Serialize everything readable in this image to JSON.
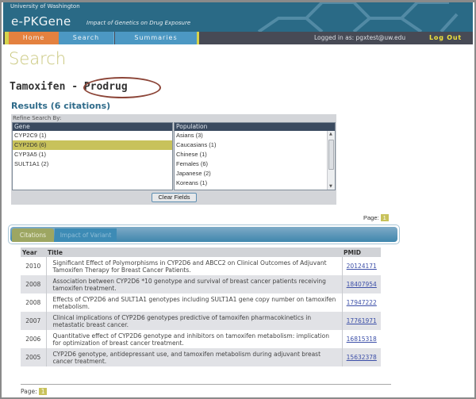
{
  "header": {
    "university": "University of Washington",
    "brand": "e-PKGene",
    "tagline": "Impact of Genetics on Drug Exposure"
  },
  "nav": {
    "tabs": [
      {
        "label": "Home",
        "active": true
      },
      {
        "label": "Search",
        "active": false
      },
      {
        "label": "Summaries",
        "active": false
      }
    ],
    "logged_in": "Logged in as: pgxtest@uw.edu",
    "logout": "Log Out"
  },
  "page": {
    "title": "Search",
    "drug_heading": "Tamoxifen - Prodrug",
    "results": "Results (6 citations)"
  },
  "refine": {
    "label": "Refine Search By:",
    "gene": {
      "header": "Gene",
      "items": [
        "CYP2C9 (1)",
        "CYP2D6 (6)",
        "CYP3A5 (1)",
        "SULT1A1 (2)"
      ],
      "selected": "CYP2D6 (6)"
    },
    "population": {
      "header": "Population",
      "items": [
        "Asians (3)",
        "Caucasians (1)",
        "Chinese (1)",
        "Females (6)",
        "Japanese (2)",
        "Koreans (1)"
      ]
    },
    "clear_button": "Clear Fields"
  },
  "pagination": {
    "label": "Page:",
    "current": "1"
  },
  "tabs": [
    {
      "label": "Citations",
      "active": true
    },
    {
      "label": "Impact of Variant",
      "active": false
    }
  ],
  "table": {
    "columns": [
      "Year",
      "Title",
      "PMID"
    ],
    "rows": [
      {
        "year": "2010",
        "title": "Significant Effect of Polymorphisms in CYP2D6 and ABCC2 on Clinical Outcomes of Adjuvant Tamoxifen Therapy for Breast Cancer Patients.",
        "pmid": "20124171"
      },
      {
        "year": "2008",
        "title": "Association between CYP2D6 *10 genotype and survival of breast cancer patients receiving tamoxifen treatment.",
        "pmid": "18407954"
      },
      {
        "year": "2008",
        "title": "Effects of CYP2D6 and SULT1A1 genotypes including SULT1A1 gene copy number on tamoxifen metabolism.",
        "pmid": "17947222"
      },
      {
        "year": "2007",
        "title": "Clinical implications of CYP2D6 genotypes predictive of tamoxifen pharmacokinetics in metastatic breast cancer.",
        "pmid": "17761971"
      },
      {
        "year": "2006",
        "title": "Quantitative effect of CYP2D6 genotype and inhibitors on tamoxifen metabolism: implication for optimization of breast cancer treatment.",
        "pmid": "16815318"
      },
      {
        "year": "2005",
        "title": "CYP2D6 genotype, antidepressant use, and tamoxifen metabolism during adjuvant breast cancer treatment.",
        "pmid": "15632378"
      }
    ]
  },
  "colors": {
    "header_bg": "#2a6a86",
    "nav_bg": "#474a55",
    "home_tab": "#e4813f",
    "accent_olive": "#c8c25b",
    "logout": "#f1e43b"
  }
}
